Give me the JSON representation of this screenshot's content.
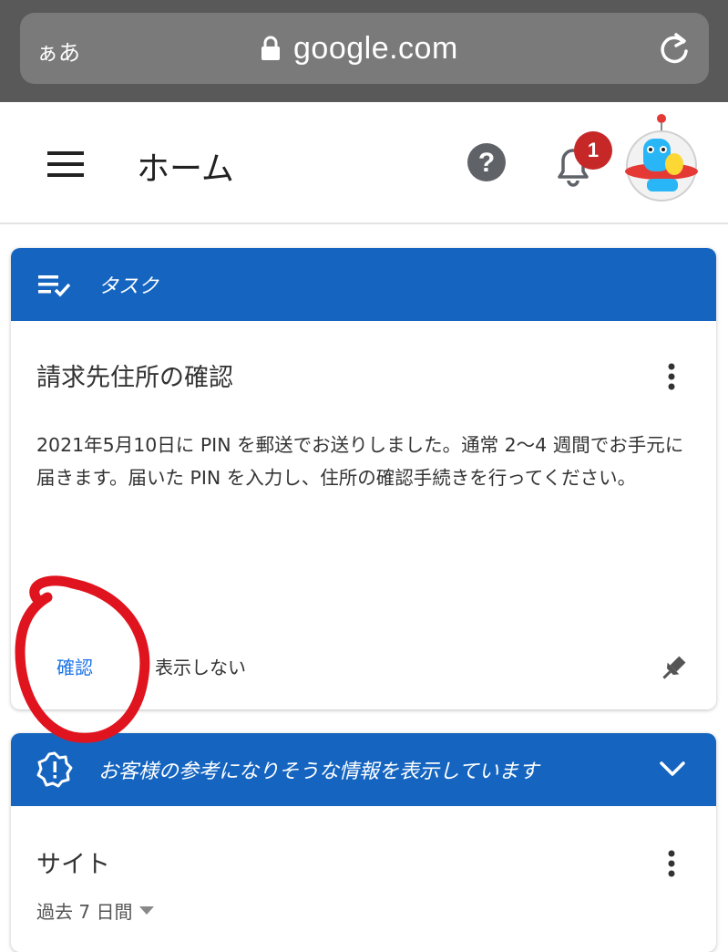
{
  "browser": {
    "text_size_label": "ぁあ",
    "url": "google.com"
  },
  "header": {
    "title": "ホーム",
    "notification_count": "1"
  },
  "task_card": {
    "header_label": "タスク",
    "title": "請求先住所の確認",
    "body": "2021年5月10日に PIN を郵送でお送りしました。通常 2〜4 週間でお手元に届きます。届いた PIN を入力し、住所の確認手続きを行ってください。",
    "confirm_label": "確認",
    "dismiss_label": "表示しない"
  },
  "info_card": {
    "header_label": "お客様の参考になりそうな情報を表示しています",
    "section_title": "サイト",
    "period_label": "過去 7 日間"
  },
  "colors": {
    "accent_blue": "#1565c0",
    "link_blue": "#1a73e8",
    "badge_red": "#c62828",
    "annotation_red": "#e0141e"
  }
}
